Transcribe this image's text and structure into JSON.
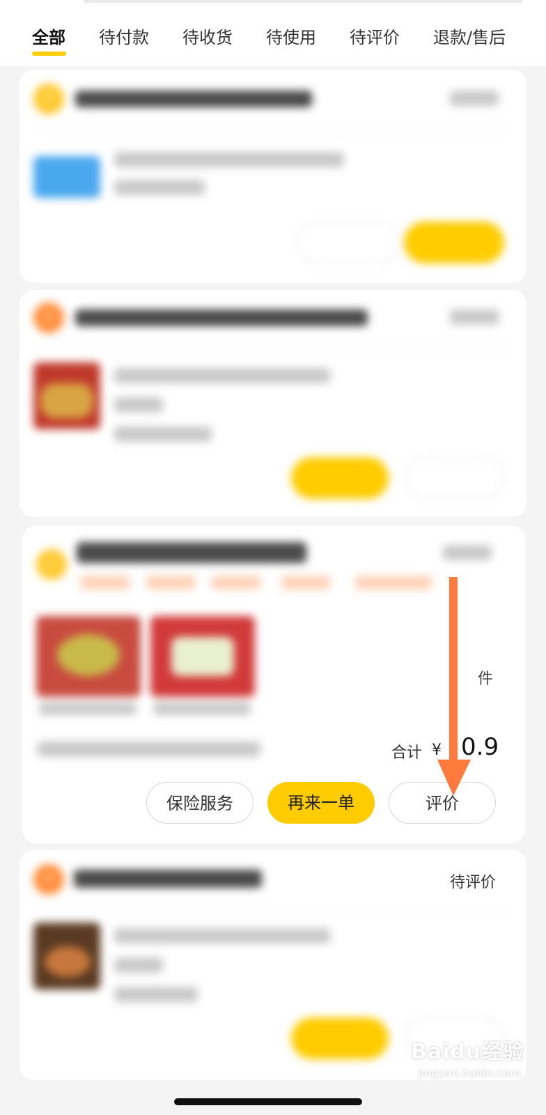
{
  "tabs": [
    "全部",
    "待付款",
    "待收货",
    "待使用",
    "待评价",
    "退款/售后"
  ],
  "order3": {
    "status_text": "",
    "total_label": "合计",
    "currency": "¥",
    "amount": "0.9",
    "qty_unit": "件",
    "buttons": {
      "insurance": "保险服务",
      "reorder": "再来一单",
      "review": "评价"
    }
  },
  "order4": {
    "status_text": "待评价"
  },
  "colors": {
    "accent": "#ffcc00",
    "arrow": "#ff7a3d"
  },
  "watermark": {
    "brand": "Baidu经验",
    "domain": "jingyan.baidu.com"
  }
}
